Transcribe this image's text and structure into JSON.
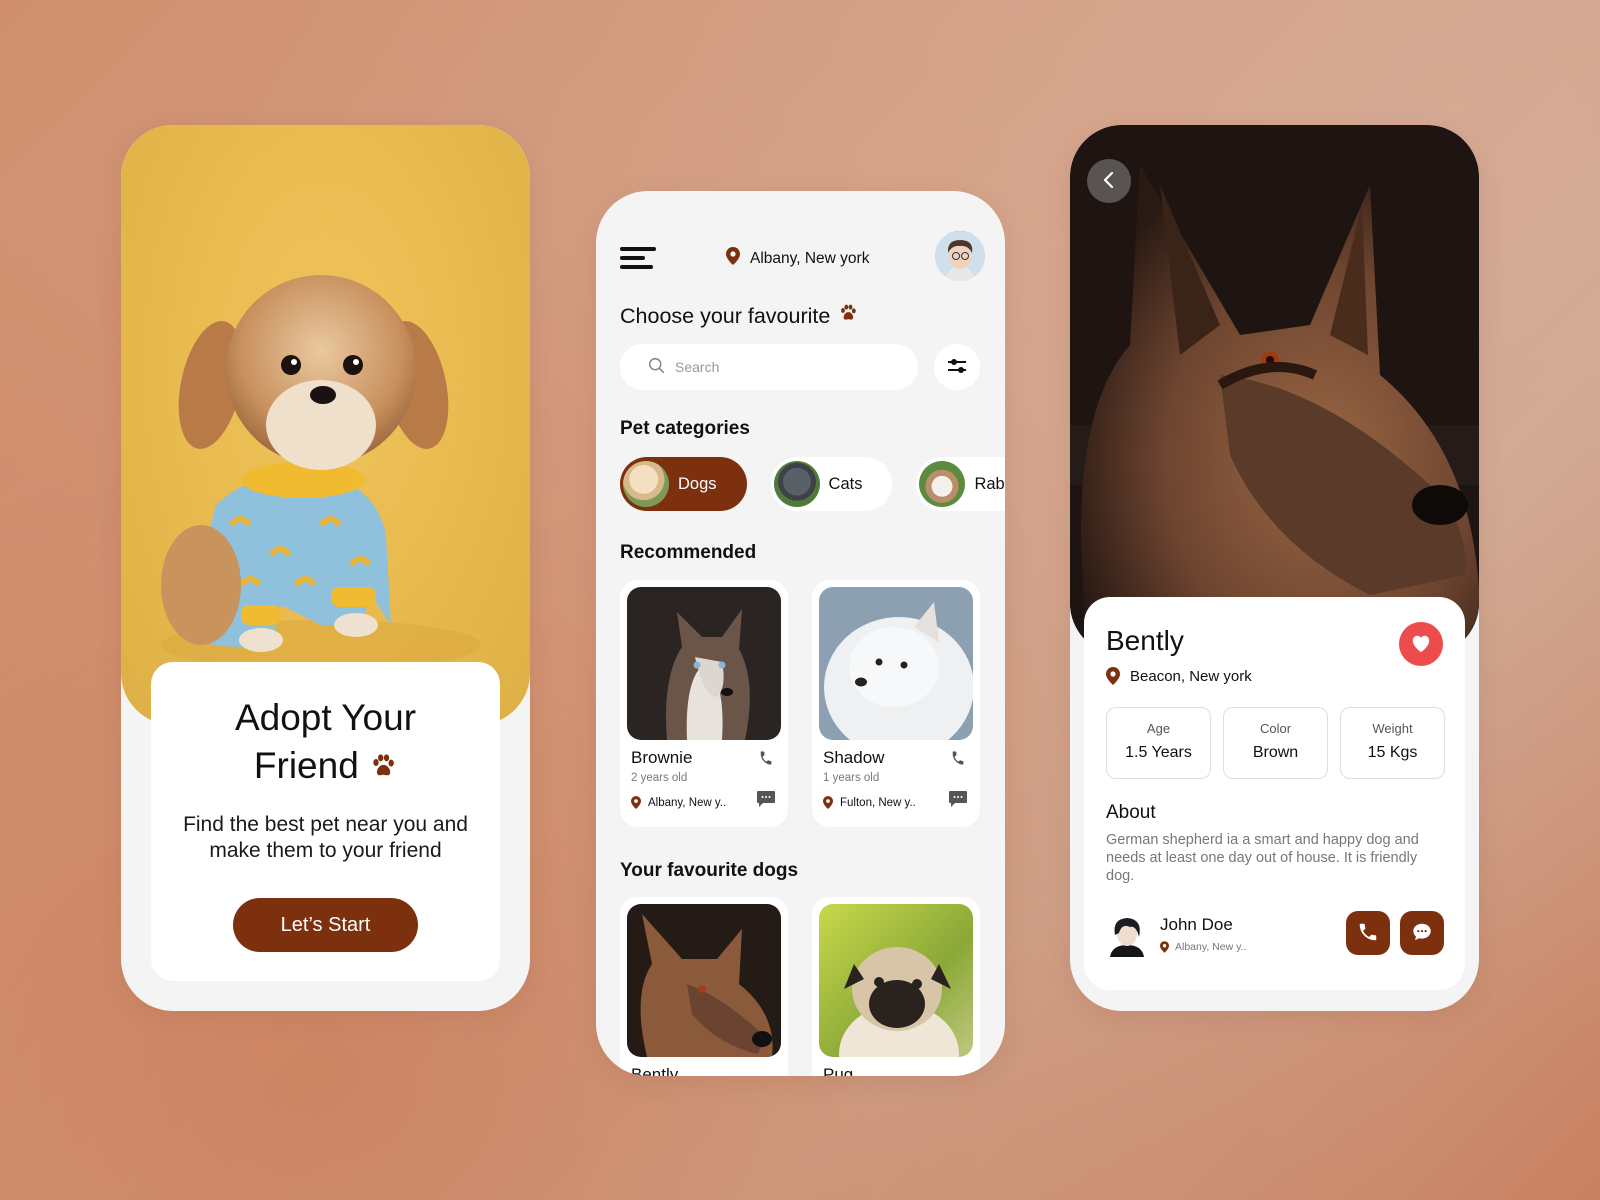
{
  "colors": {
    "brand_brown": "#7c300e",
    "heart_red": "#ec4c4c",
    "hero_yellow": "#e8bb50",
    "screen_bg": "#f4f4f4"
  },
  "onboarding": {
    "title_line1": "Adopt Your",
    "title_line2": "Friend",
    "title_icon": "paw-icon",
    "subtitle": "Find the best pet near you and make them to your friend",
    "start_button": "Let’s Start"
  },
  "home": {
    "menu_icon": "hamburger-menu-icon",
    "location": "Albany, New york",
    "location_icon": "map-pin-icon",
    "avatar_icon": "user-avatar",
    "heading": "Choose your favourite",
    "heading_icon": "paw-icon",
    "search": {
      "placeholder": "Search",
      "value": "",
      "icon": "search-icon"
    },
    "filter_icon": "sliders-icon",
    "categories_title": "Pet categories",
    "categories": [
      {
        "label": "Dogs",
        "active": true
      },
      {
        "label": "Cats",
        "active": false
      },
      {
        "label": "Rabbit",
        "active": false
      }
    ],
    "recommended_title": "Recommended",
    "recommended": [
      {
        "name": "Brownie",
        "age": "2 years old",
        "location": "Albany, New y.."
      },
      {
        "name": "Shadow",
        "age": "1 years old",
        "location": "Fulton, New y.."
      }
    ],
    "favourites_title": "Your favourite dogs",
    "favourites": [
      {
        "name": "Bently"
      },
      {
        "name": "Pug"
      }
    ]
  },
  "detail": {
    "back_icon": "chevron-left-icon",
    "name": "Bently",
    "favorite_icon": "heart-icon",
    "location": "Beacon, New york",
    "stats": [
      {
        "label": "Age",
        "value": "1.5 Years"
      },
      {
        "label": "Color",
        "value": "Brown"
      },
      {
        "label": "Weight",
        "value": "15 Kgs"
      }
    ],
    "about_title": "About",
    "about_text": "German shepherd ia a smart and happy dog and needs at least one day out of  house. It is friendly dog.",
    "owner": {
      "name": "John Doe",
      "location": "Albany, New y.."
    },
    "call_icon": "phone-icon",
    "message_icon": "chat-bubble-icon"
  }
}
